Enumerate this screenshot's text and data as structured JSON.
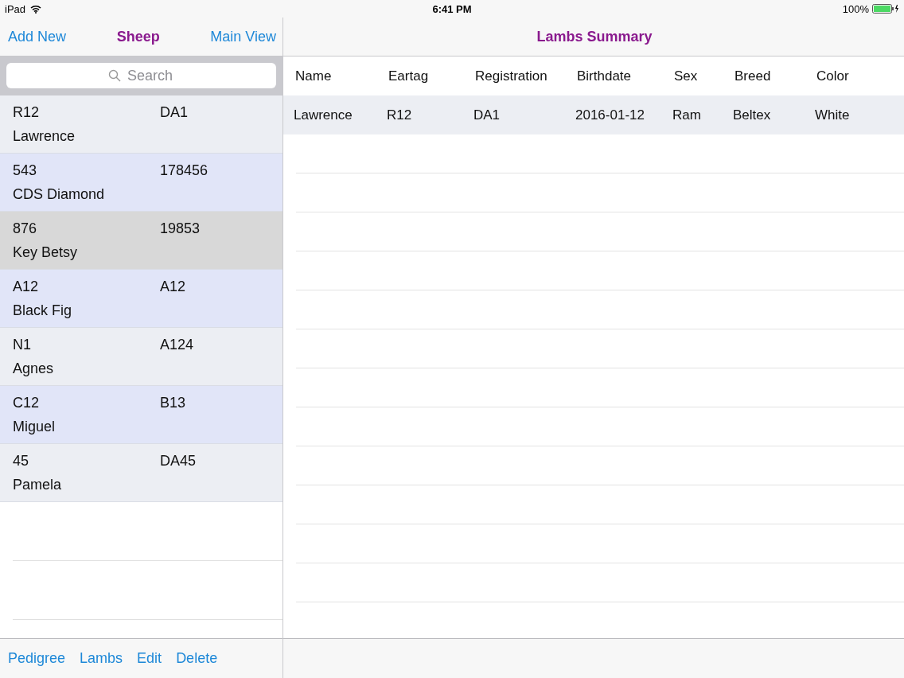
{
  "status_bar": {
    "device": "iPad",
    "time": "6:41 PM",
    "battery": "100%"
  },
  "sidebar": {
    "nav": {
      "left": "Add New",
      "title": "Sheep",
      "right": "Main View"
    },
    "search": {
      "placeholder": "Search"
    },
    "items": [
      {
        "eartag": "R12",
        "registration": "DA1",
        "name": "Lawrence",
        "selected": false
      },
      {
        "eartag": "543",
        "registration": "178456",
        "name": "CDS Diamond",
        "selected": false
      },
      {
        "eartag": "876",
        "registration": "19853",
        "name": "Key Betsy",
        "selected": true
      },
      {
        "eartag": "A12",
        "registration": "A12",
        "name": "Black Fig",
        "selected": false
      },
      {
        "eartag": "N1",
        "registration": "A124",
        "name": "Agnes",
        "selected": false
      },
      {
        "eartag": "C12",
        "registration": "B13",
        "name": "Miguel",
        "selected": false
      },
      {
        "eartag": "45",
        "registration": "DA45",
        "name": "Pamela",
        "selected": false
      }
    ],
    "toolbar": [
      "Pedigree",
      "Lambs",
      "Edit",
      "Delete"
    ]
  },
  "main": {
    "title": "Lambs Summary",
    "table": {
      "columns": [
        "Name",
        "Eartag",
        "Registration",
        "Birthdate",
        "Sex",
        "Breed",
        "Color"
      ],
      "rows": [
        [
          "Lawrence",
          "R12",
          "DA1",
          "2016-01-12",
          "Ram",
          "Beltex",
          "White"
        ]
      ]
    }
  }
}
